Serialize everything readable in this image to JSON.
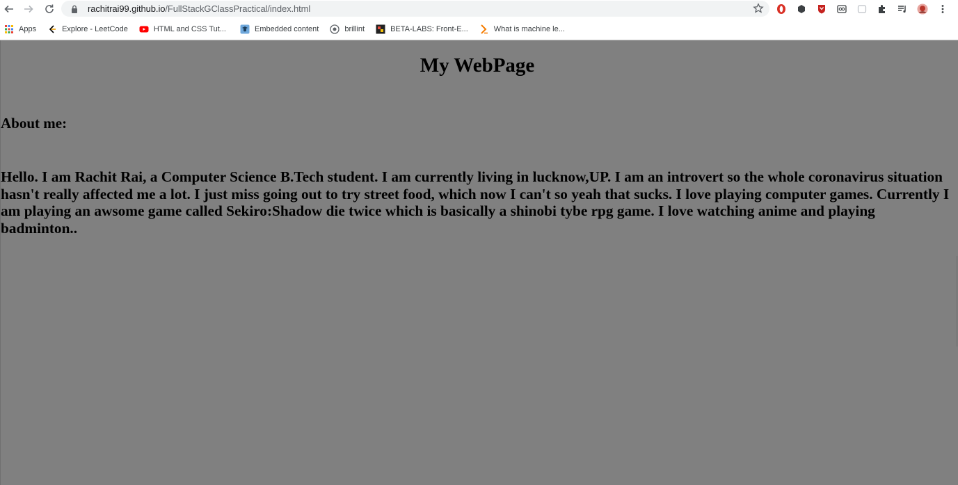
{
  "browser": {
    "url_host": "rachitrai99.github.io",
    "url_path": "/FullStackGClassPractical/index.html",
    "bookmarks": [
      {
        "label": "Apps",
        "icon": "apps-grid-icon"
      },
      {
        "label": "Explore - LeetCode",
        "icon": "leetcode-icon"
      },
      {
        "label": "HTML and CSS Tut...",
        "icon": "youtube-icon"
      },
      {
        "label": "Embedded content",
        "icon": "embedded-icon"
      },
      {
        "label": "brillint",
        "icon": "brilliant-icon"
      },
      {
        "label": "BETA-LABS: Front-E...",
        "icon": "betalabs-icon"
      },
      {
        "label": "What is machine le...",
        "icon": "article-icon"
      }
    ],
    "colors": {
      "accent_red": "#d93025",
      "chrome_bg": "#ffffff",
      "omnibox_bg": "#f1f3f4"
    }
  },
  "page": {
    "background": "#808080",
    "title": "My WebPage",
    "about_heading": "About me:",
    "about_text": "Hello. I am Rachit Rai, a Computer Science B.Tech student. I am currently living in lucknow,UP. I am an introvert so the whole coronavirus situation hasn't really affected me a lot. I just miss going out to try street food, which now I can't so yeah that sucks. I love playing computer games. Currently I am playing an awsome game called Sekiro:Shadow die twice which is basically a shinobi tybe rpg game. I love watching anime and playing badminton.."
  }
}
